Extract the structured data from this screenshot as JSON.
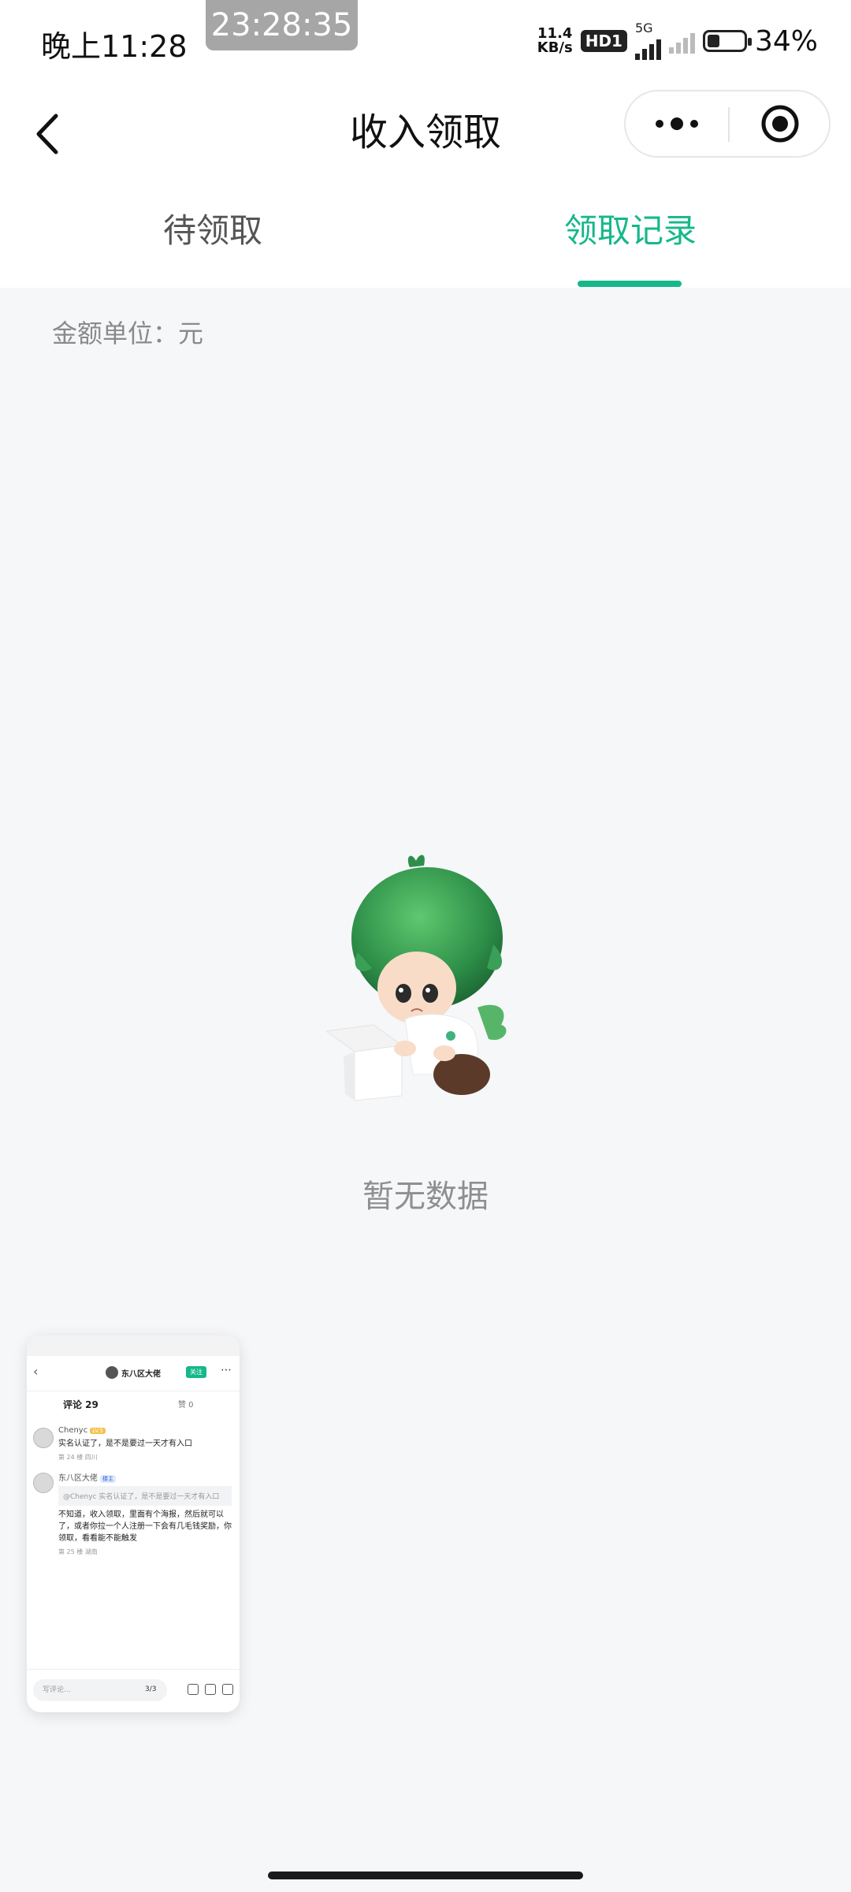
{
  "status_bar": {
    "time": "晚上11:28",
    "clock_overlay": "23:28:35",
    "net_speed_value": "11.4",
    "net_speed_unit": "KB/s",
    "hd_label": "HD1",
    "network": "5G",
    "battery_percent": "34%",
    "battery_level": 0.34
  },
  "nav": {
    "title": "收入领取",
    "back_icon": "chevron-left-icon",
    "more_icon": "more-dots-icon",
    "close_icon": "target-circle-icon"
  },
  "tabs": [
    {
      "label": "待领取",
      "active": false
    },
    {
      "label": "领取记录",
      "active": true
    }
  ],
  "colors": {
    "accent": "#15b88a",
    "background": "#f6f7f9"
  },
  "unit_label": "金额单位：元",
  "empty_state": {
    "text": "暂无数据",
    "illustration": "green-hair-mascot-box-illustration"
  },
  "floating_thumbnail": {
    "username": "东八区大佬",
    "follow_label": "关注",
    "comments_label": "评论 29",
    "likes_label": "赞 0",
    "comments": [
      {
        "user": "Chenyc",
        "badge": "LV.5",
        "text": "实名认证了，是不是要过一天才有入口",
        "meta": "第 24 楼   四川"
      },
      {
        "user": "东八区大佬",
        "badge": "楼主",
        "quote": "@Chenyc 实名认证了，是不是要过一天才有入口",
        "text": "不知道，收入领取，里面有个海报，然后就可以了，或者你拉一个人注册一下会有几毛钱奖励，你领取，看看能不能触发",
        "meta": "第 25 楼   湖南"
      }
    ],
    "input_placeholder": "写评论...",
    "page_indicator": "3/3"
  }
}
